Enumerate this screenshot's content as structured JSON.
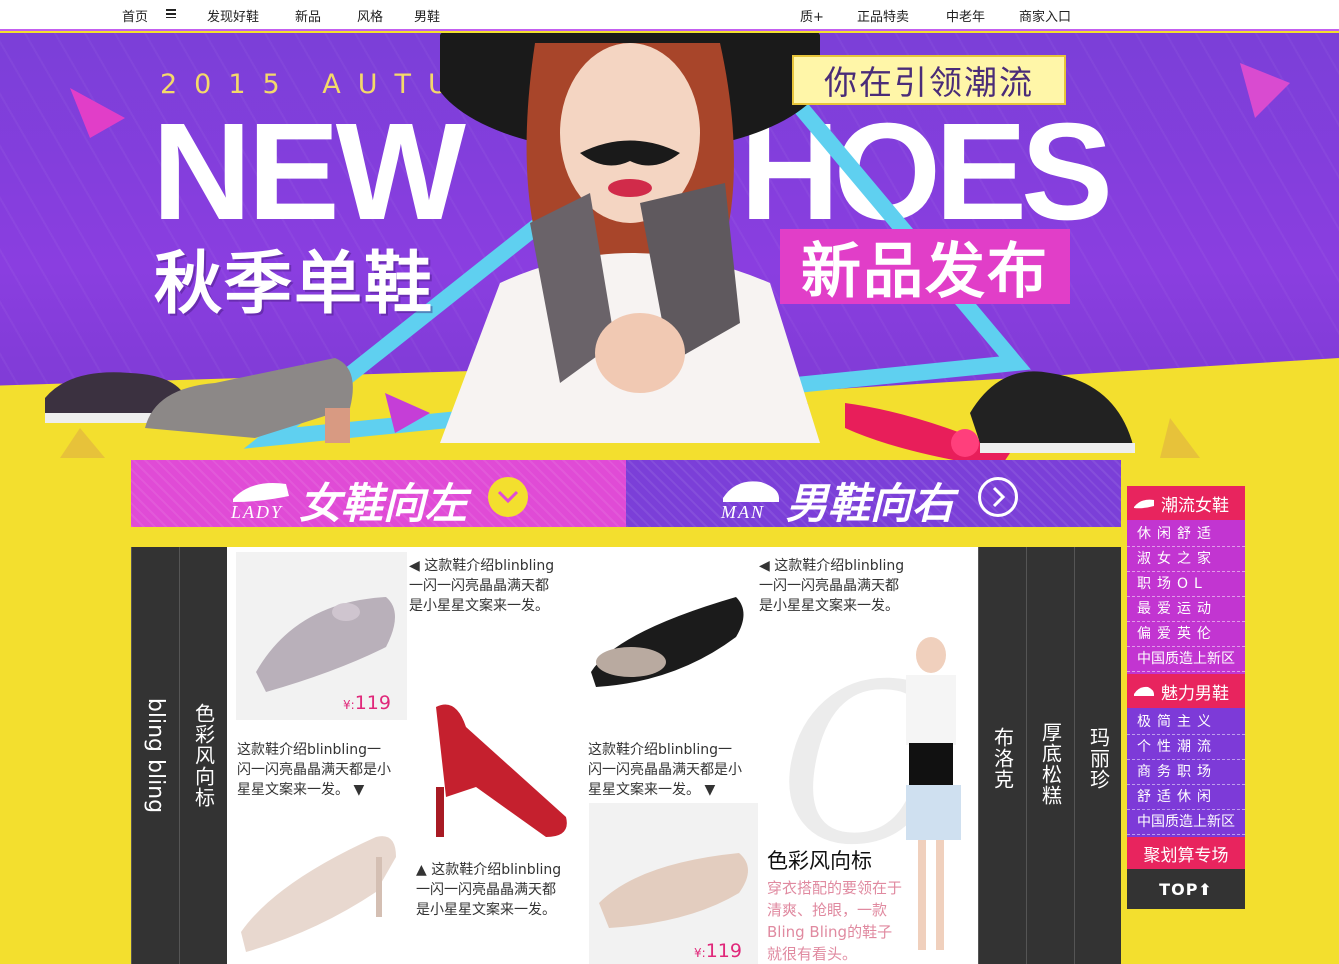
{
  "nav": {
    "left": [
      "首页",
      "发现好鞋",
      "新品",
      "风格",
      "男鞋"
    ],
    "right": [
      "质+",
      "正品特卖",
      "中老年",
      "商家入口"
    ]
  },
  "hero": {
    "autumn": "2015 AUTUM",
    "headline_left": "NEW",
    "headline_right": "HOES",
    "slogan": "你在引领潮流",
    "cn_left": "秋季单鞋",
    "cn_right": "新品发布",
    "colors": {
      "purple": "#7b3fd8",
      "magenta": "#e13ec8",
      "yellow": "#f3df2e",
      "cyan": "#5fd0f0"
    }
  },
  "banners": {
    "lady": {
      "text": "女鞋向左",
      "sub": "LADY"
    },
    "man": {
      "text": "男鞋向右",
      "sub": "MAN"
    }
  },
  "tabs": {
    "left": [
      "bling bling",
      "色彩风向标"
    ],
    "right": [
      "布洛克",
      "厚底松糕",
      "玛丽珍"
    ]
  },
  "products": {
    "p1": {
      "desc": "这款鞋介绍blinbling一闪一闪亮晶晶满天都是小星星文案来一发。",
      "price_symbol": "¥:",
      "price": "119"
    },
    "p2": {
      "desc": "这款鞋介绍blinbling一闪一闪亮晶晶满天都是小星星文案来一发。"
    },
    "p3": {
      "desc": "这款鞋介绍blinbling一闪一闪亮晶晶满天都是小星星文案来一发。"
    },
    "p4": {
      "desc": "这款鞋介绍blinbling一闪一闪亮晶晶满天都是小星星文案来一发。"
    },
    "p5": {
      "desc": "这款鞋介绍blinbling一闪一闪亮晶晶满天都是小星星文案来一发。"
    },
    "p6": {
      "price_symbol": "¥:",
      "price": "119"
    }
  },
  "feature": {
    "title": "色彩风向标",
    "text": "穿衣搭配的要领在于清爽、抢眼，一款Bling Bling的鞋子就很有看头。",
    "big_letter": "C"
  },
  "sidebar": {
    "women_title": "潮流女鞋",
    "women_items": [
      "休闲舒适",
      "淑女之家",
      "职场OL",
      "最爱运动",
      "偏爱英伦",
      "中国质造上新区"
    ],
    "men_title": "魅力男鞋",
    "men_items": [
      "极简主义",
      "个性潮流",
      "商务职场",
      "舒适休闲",
      "中国质造上新区"
    ],
    "deal": "聚划算专场",
    "top": "TOP"
  }
}
